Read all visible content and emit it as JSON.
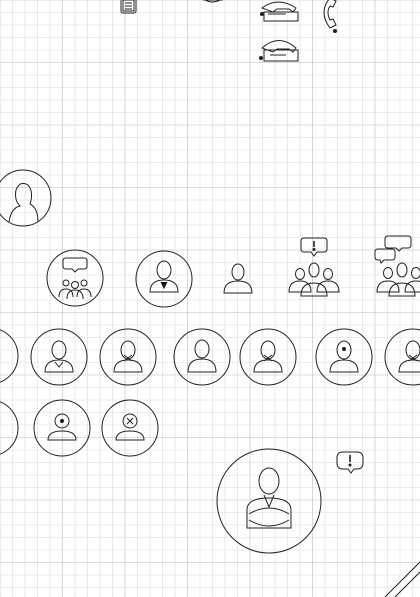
{
  "canvas": {
    "background": "#ffffff",
    "grid_minor_color": "#dcdcdc",
    "grid_major_color": "#bcbcbc",
    "stroke_color": "#222222",
    "accent_fill": "#111111"
  },
  "palette_items": [
    {
      "icon": "telephone-icon"
    },
    {
      "icon": "handset-icon"
    },
    {
      "icon": "telephone-icon"
    },
    {
      "icon": "mobile-phone-icon"
    },
    {
      "icon": "person-circle-icon"
    },
    {
      "icon": "chat-group-circle-icon"
    },
    {
      "icon": "user-circle-icon"
    },
    {
      "icon": "user-icon"
    },
    {
      "icon": "alert-group-icon"
    },
    {
      "icon": "chat-group-icon"
    },
    {
      "icon": "user-tie-circle-icon"
    },
    {
      "icon": "user-bowtie-circle-icon"
    },
    {
      "icon": "user-plain-circle-icon"
    },
    {
      "icon": "user-bowtie-circle-icon"
    },
    {
      "icon": "user-dot-circle-icon"
    },
    {
      "icon": "user-woman-circle-icon"
    },
    {
      "icon": "user-partial-circle-icon"
    },
    {
      "icon": "user-dot-circle-icon"
    },
    {
      "icon": "user-cross-circle-icon"
    },
    {
      "icon": "alert-bubble-icon"
    },
    {
      "icon": "user-arms-crossed-circle-icon"
    }
  ]
}
